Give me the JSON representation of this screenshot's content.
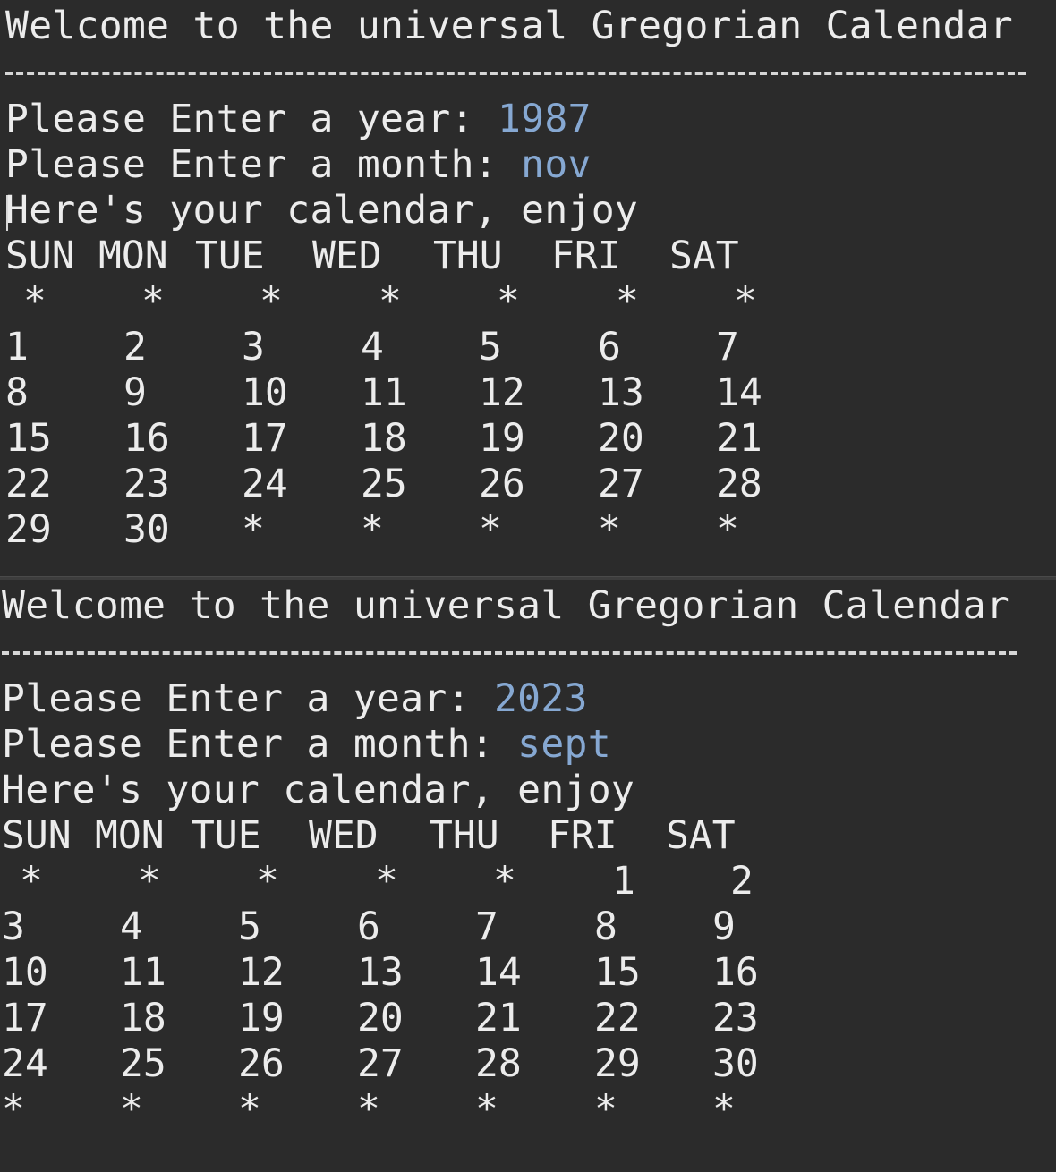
{
  "sessions": [
    {
      "welcome": "Welcome to the universal Gregorian Calendar",
      "year_prompt": "Please Enter a year: ",
      "year_input": "1987",
      "month_prompt": "Please Enter a month: ",
      "month_input": "nov",
      "result_line": "Here's your calendar, enjoy",
      "weekdays": [
        "SUN",
        "MON",
        "TUE",
        "WED",
        "THU",
        "FRI",
        "SAT"
      ],
      "rows": [
        [
          "*",
          "*",
          "*",
          "*",
          "*",
          "*",
          "*"
        ],
        [
          "1",
          "2",
          "3",
          "4",
          "5",
          "6",
          "7"
        ],
        [
          "8",
          "9",
          "10",
          "11",
          "12",
          "13",
          "14"
        ],
        [
          "15",
          "16",
          "17",
          "18",
          "19",
          "20",
          "21"
        ],
        [
          "22",
          "23",
          "24",
          "25",
          "26",
          "27",
          "28"
        ],
        [
          "29",
          "30",
          "*",
          "*",
          "*",
          "*",
          "*"
        ]
      ]
    },
    {
      "welcome": "Welcome to the universal Gregorian Calendar",
      "year_prompt": "Please Enter a year: ",
      "year_input": "2023",
      "month_prompt": "Please Enter a month: ",
      "month_input": "sept",
      "result_line": "Here's your calendar, enjoy",
      "weekdays": [
        "SUN",
        "MON",
        "TUE",
        "WED",
        "THU",
        "FRI",
        "SAT"
      ],
      "rows": [
        [
          "*",
          "*",
          "*",
          "*",
          "*",
          "1",
          "2"
        ],
        [
          "3",
          "4",
          "5",
          "6",
          "7",
          "8",
          "9"
        ],
        [
          "10",
          "11",
          "12",
          "13",
          "14",
          "15",
          "16"
        ],
        [
          "17",
          "18",
          "19",
          "20",
          "21",
          "22",
          "23"
        ],
        [
          "24",
          "25",
          "26",
          "27",
          "28",
          "29",
          "30"
        ],
        [
          "*",
          "*",
          "*",
          "*",
          "*",
          "*",
          "*"
        ]
      ]
    }
  ],
  "colors": {
    "background": "#2b2b2b",
    "text": "#ececec",
    "user_input": "#86a8d2"
  }
}
